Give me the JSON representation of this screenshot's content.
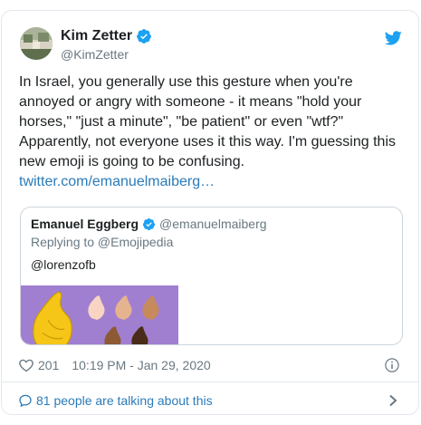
{
  "author": {
    "name": "Kim Zetter",
    "handle": "@KimZetter"
  },
  "tweet": {
    "text": "In Israel, you generally use this gesture when you're annoyed or angry with someone - it means \"hold your horses,\" \"just a minute\", \"be patient\" or even \"wtf?\" Apparently, not everyone uses it this way. I'm guessing this new emoji is going to be confusing.",
    "link": "twitter.com/emanuelmaiberg…"
  },
  "quoted": {
    "name": "Emanuel Eggberg",
    "handle": "@emanuelmaiberg",
    "reply_to": "Replying to @Emojipedia",
    "text": "@lorenzofb"
  },
  "meta": {
    "likes": "201",
    "timestamp": "10:19 PM - Jan 29, 2020"
  },
  "footer": {
    "talking": "81 people are talking about this"
  },
  "colors": {
    "accent": "#2b7bb9",
    "verified": "#1da1f2",
    "muted": "#697882",
    "media_bg": "#a07fd0"
  },
  "icons": [
    "twitter-bird-icon",
    "verified-icon",
    "heart-icon",
    "info-icon",
    "comment-icon",
    "chevron-right-icon"
  ]
}
